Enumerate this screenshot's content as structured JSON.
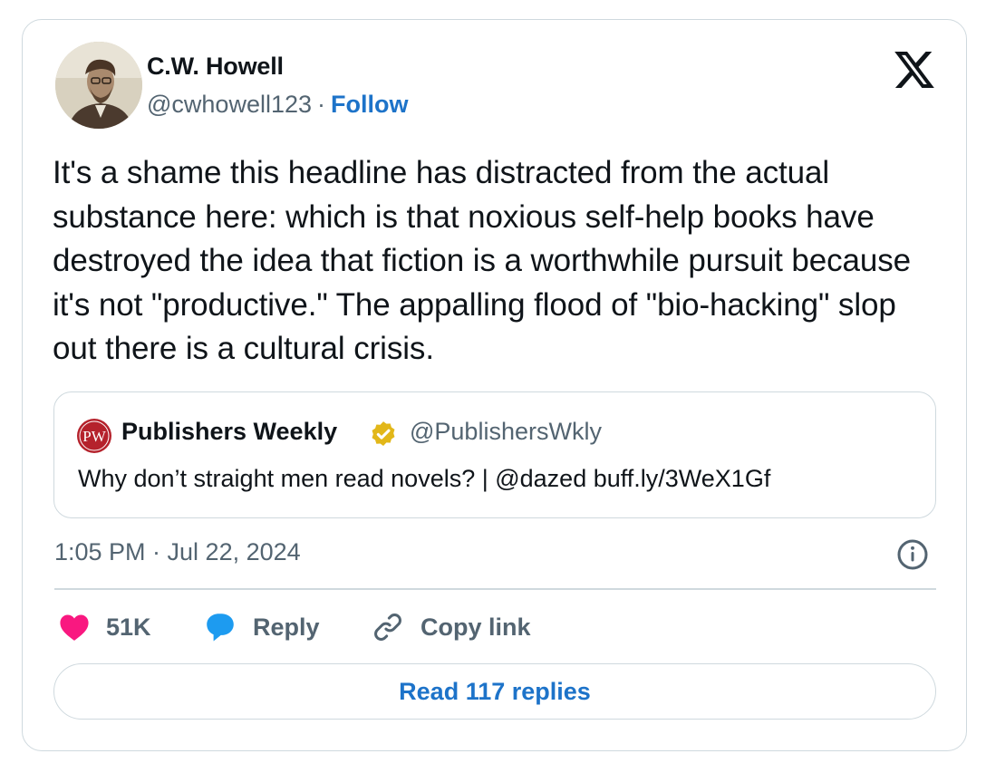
{
  "author": {
    "name": "C.W. Howell",
    "handle": "@cwhowell123",
    "separator": "·",
    "follow_label": "Follow",
    "avatar": "avatar-photo"
  },
  "brand_icon": "x-logo-icon",
  "tweet": {
    "text": "It's a shame this headline has distracted from the actual substance here: which is that noxious self-help books have destroyed the idea that fiction is a worthwhile pursuit because it's not \"productive.\" The appalling flood of \"bio-hacking\" slop out there is a cultural crisis.",
    "timestamp": "1:05 PM · Jul 22, 2024"
  },
  "quoted": {
    "logo_text": "PW",
    "name": "Publishers Weekly",
    "verified_icon": "gold-verified-badge-icon",
    "handle": "@PublishersWkly",
    "text": "Why don’t straight men read novels? | @dazed buff.ly/3WeX1Gf"
  },
  "actions": {
    "like_count": "51K",
    "reply_label": "Reply",
    "copy_label": "Copy link"
  },
  "read_replies_label": "Read 117 replies",
  "colors": {
    "link_blue": "#1d73c9",
    "heart_pink": "#f91880",
    "reply_blue": "#1d9bf0",
    "secondary_gray": "#536471",
    "border": "#cfd9de",
    "pw_red": "#b5222c",
    "verified_gold": "#e2b719"
  }
}
